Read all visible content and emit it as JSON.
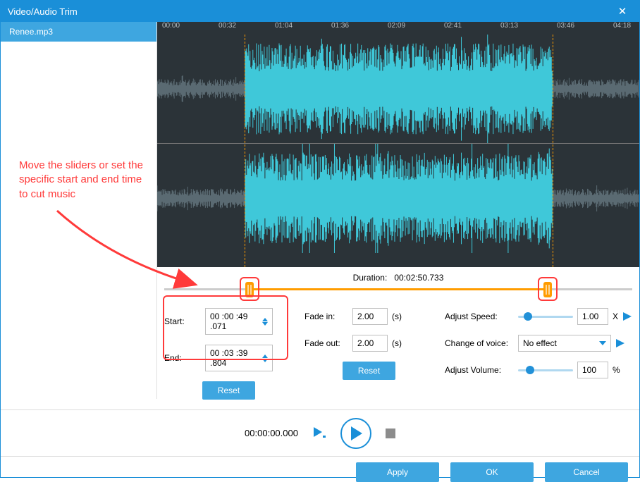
{
  "window": {
    "title": "Video/Audio Trim",
    "close": "✕"
  },
  "sidebar": {
    "items": [
      {
        "label": "Renee.mp3"
      }
    ]
  },
  "ruler": [
    "00:00",
    "00:32",
    "01:04",
    "01:36",
    "02:09",
    "02:41",
    "03:13",
    "03:46",
    "04:18"
  ],
  "trim": {
    "duration_label": "Duration:",
    "duration_value": "00:02:50.733",
    "start_label": "Start:",
    "start_value": "00 :00 :49 .071",
    "end_label": "End:",
    "end_value": "00 :03 :39 .804",
    "reset": "Reset",
    "start_pct": 18.2,
    "end_pct": 82.0
  },
  "fade": {
    "in_label": "Fade in:",
    "in_value": "2.00",
    "out_label": "Fade out:",
    "out_value": "2.00",
    "unit": "(s)",
    "reset": "Reset"
  },
  "adjust": {
    "speed_label": "Adjust Speed:",
    "speed_value": "1.00",
    "speed_unit": "X",
    "voice_label": "Change of voice:",
    "voice_value": "No effect",
    "volume_label": "Adjust Volume:",
    "volume_value": "100",
    "volume_unit": "%"
  },
  "playback": {
    "time": "00:00:00.000"
  },
  "footer": {
    "apply": "Apply",
    "ok": "OK",
    "cancel": "Cancel"
  },
  "annotation": {
    "text": "Move the sliders or set the specific start and end time to cut music"
  }
}
